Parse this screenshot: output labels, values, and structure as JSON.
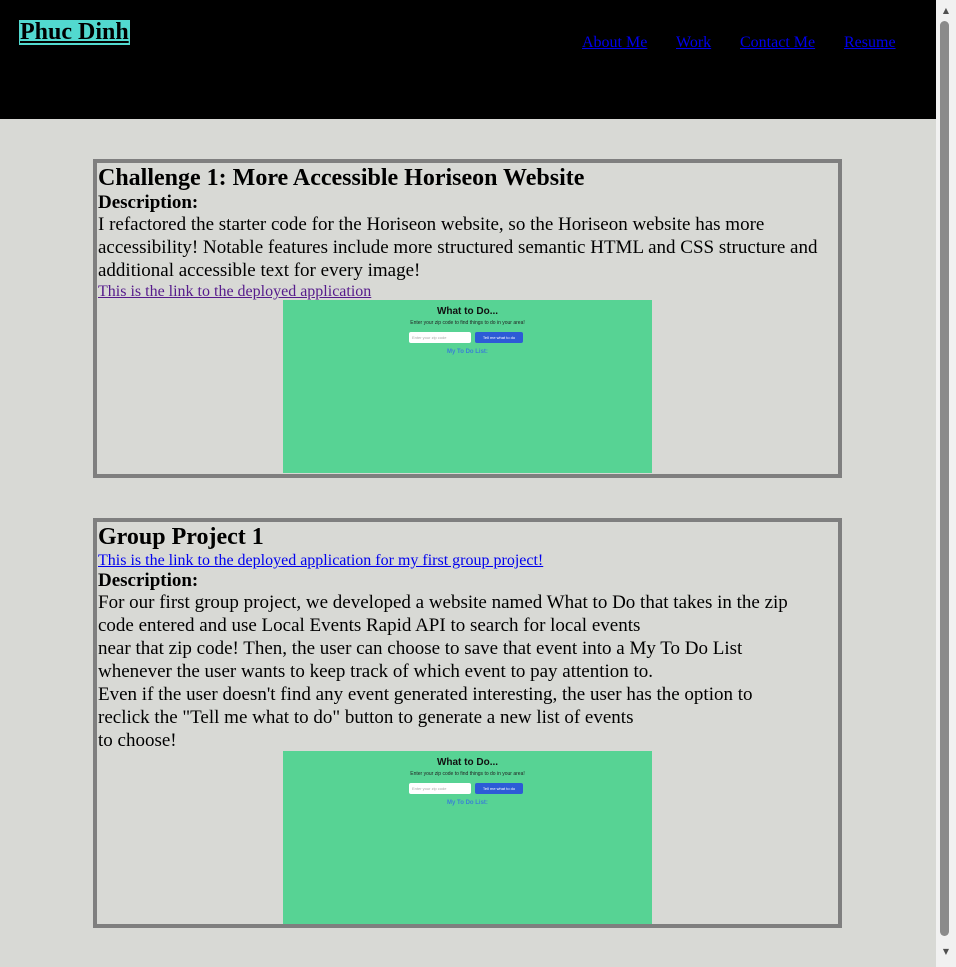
{
  "header": {
    "brand": "Phuc Dinh",
    "nav": [
      {
        "label": "About Me"
      },
      {
        "label": "Work"
      },
      {
        "label": "Contact Me"
      },
      {
        "label": "Resume"
      }
    ]
  },
  "projects": [
    {
      "title": "Challenge 1: More Accessible Horiseon Website",
      "description_label": "Description:",
      "description": [
        "I refactored the starter code for the Horiseon website, so the Horiseon website has more accessibility! Notable features include more structured semantic HTML and CSS structure and additional accessible text for every image!"
      ],
      "link": "This is the link to the deployed application",
      "screenshot": {
        "title": "What to Do...",
        "subtitle": "Enter your zip code to find things to do in your area!",
        "input_placeholder": "Enter your zip code",
        "button": "Tell me what to do",
        "list": "My To Do List:"
      }
    },
    {
      "title": "Group Project 1",
      "link": "This is the link to the deployed application for my first group project!",
      "description_label": "Description:",
      "description": [
        "For our first group project, we developed a website named What to Do that takes in the zip code entered and use Local Events Rapid API to search for local events",
        "near that zip code! Then, the user can choose to save that event into a My To Do List whenever the user wants to keep track of which event to pay attention to.",
        "Even if the user doesn't find any event generated interesting, the user has the option to reclick the \"Tell me what to do\" button to generate a new list of events",
        "to choose!"
      ],
      "screenshot": {
        "title": "What to Do...",
        "subtitle": "Enter your zip code to find things to do in your area!",
        "input_placeholder": "Enter your zip code",
        "button": "Tell me what to do",
        "list": "My To Do List:"
      }
    }
  ],
  "colors": {
    "header_bg": "#000000",
    "brand_bg": "#52d9cf",
    "page_bg": "#d8d9d5",
    "card_border": "#7f7f7f",
    "screenshot_bg": "#57d394",
    "link": "#0000ee",
    "visited_link": "#551a8b"
  },
  "icons": {
    "scroll_up": "triangle-up-icon",
    "scroll_down": "triangle-down-icon"
  }
}
